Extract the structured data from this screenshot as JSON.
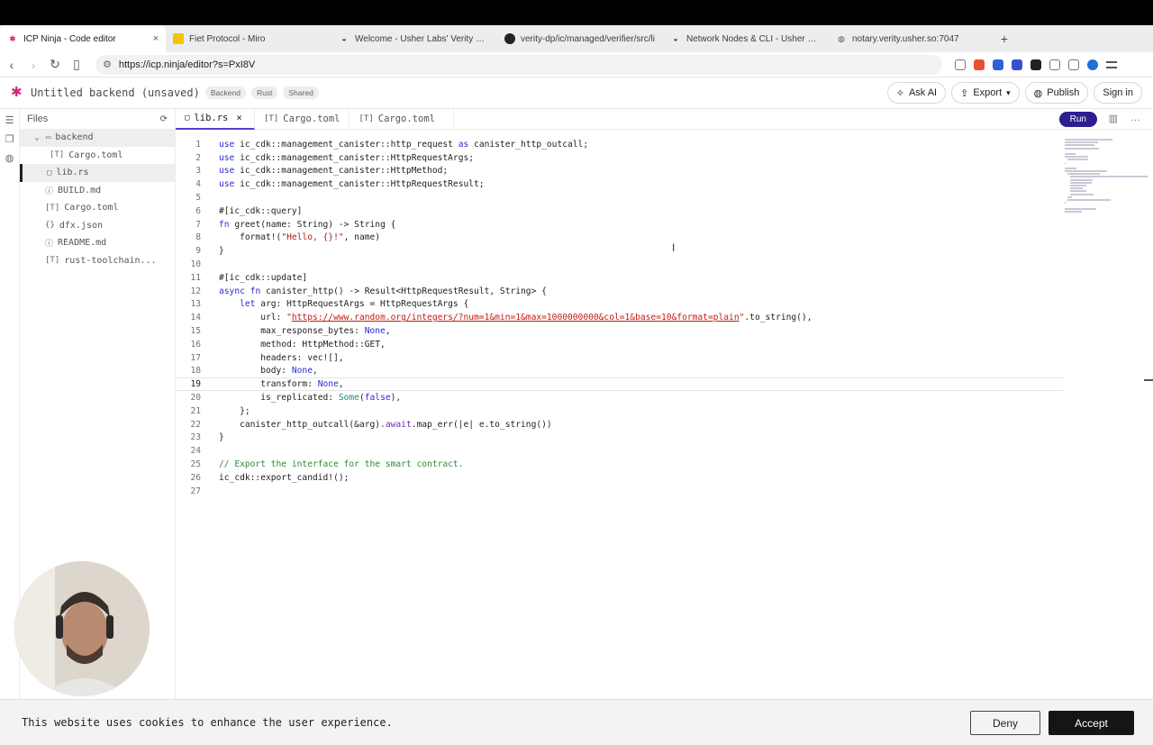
{
  "browser": {
    "tabs": [
      {
        "title": "ICP Ninja - Code editor",
        "icon": "icp-ninja-icon",
        "active": true
      },
      {
        "title": "Fiet Protocol - Miro",
        "icon": "miro-icon",
        "active": false
      },
      {
        "title": "Welcome - Usher Labs' Verity Doc",
        "icon": "usher-icon",
        "active": false
      },
      {
        "title": "verity-dp/ic/managed/verifier/src/li",
        "icon": "github-icon",
        "active": false
      },
      {
        "title": "Network Nodes & CLI - Usher Lab",
        "icon": "usher-icon",
        "active": false
      },
      {
        "title": "notary.verity.usher.so:7047",
        "icon": "globe-icon",
        "active": false
      }
    ],
    "close_tab": "×",
    "new_tab": "+",
    "url": "https://icp.ninja/editor?s=PxI8V"
  },
  "app": {
    "title": "Untitled backend (unsaved)",
    "tags": [
      "Backend",
      "Rust",
      "Shared"
    ],
    "buttons": {
      "ask_ai": "Ask AI",
      "export": "Export",
      "publish": "Publish",
      "sign_in": "Sign in"
    }
  },
  "sidebar": {
    "header": "Files",
    "items": [
      {
        "name": "backend",
        "icon": "folder-icon",
        "indent": 0,
        "state": "selected"
      },
      {
        "name": "Cargo.toml",
        "icon": "toml-file-icon",
        "indent": 1,
        "state": ""
      },
      {
        "name": "lib.rs",
        "icon": "rust-file-icon",
        "indent": 1,
        "state": "active"
      },
      {
        "name": "BUILD.md",
        "icon": "info-file-icon",
        "indent": 0,
        "state": ""
      },
      {
        "name": "Cargo.toml",
        "icon": "toml-file-icon",
        "indent": 0,
        "state": ""
      },
      {
        "name": "dfx.json",
        "icon": "json-file-icon",
        "indent": 0,
        "state": ""
      },
      {
        "name": "README.md",
        "icon": "info-file-icon",
        "indent": 0,
        "state": ""
      },
      {
        "name": "rust-toolchain...",
        "icon": "toml-file-icon",
        "indent": 0,
        "state": ""
      }
    ]
  },
  "editor": {
    "tabs": [
      {
        "label": "lib.rs",
        "active": true
      },
      {
        "label": "Cargo.toml",
        "active": false
      },
      {
        "label": "Cargo.toml",
        "active": false
      }
    ],
    "run": "Run",
    "current_line": 19,
    "lines": [
      "use ic_cdk::management_canister::http_request as canister_http_outcall;",
      "use ic_cdk::management_canister::HttpRequestArgs;",
      "use ic_cdk::management_canister::HttpMethod;",
      "use ic_cdk::management_canister::HttpRequestResult;",
      "",
      "#[ic_cdk::query]",
      "fn greet(name: String) -> String {",
      "    format!(\"Hello, {}!\", name)",
      "}",
      "",
      "#[ic_cdk::update]",
      "async fn canister_http() -> Result<HttpRequestResult, String> {",
      "    let arg: HttpRequestArgs = HttpRequestArgs {",
      "        url: \"https://www.random.org/integers/?num=1&min=1&max=1000000000&col=1&base=10&format=plain\".to_string(),",
      "        max_response_bytes: None,",
      "        method: HttpMethod::GET,",
      "        headers: vec![],",
      "        body: None,",
      "        transform: None,",
      "        is_replicated: Some(false),",
      "    };",
      "    canister_http_outcall(&arg).await.map_err(|e| e.to_string())",
      "}",
      "",
      "// Export the interface for the smart contract.",
      "ic_cdk::export_candid!();",
      ""
    ]
  },
  "cookie": {
    "text": "This website uses cookies to enhance the user experience.",
    "deny": "Deny",
    "accept": "Accept"
  },
  "colors": {
    "accent": "#2d1f8f",
    "brand": "#d3267a",
    "keyword": "#2b2bd4",
    "string": "#b11b1b",
    "comment": "#2f8a37"
  }
}
